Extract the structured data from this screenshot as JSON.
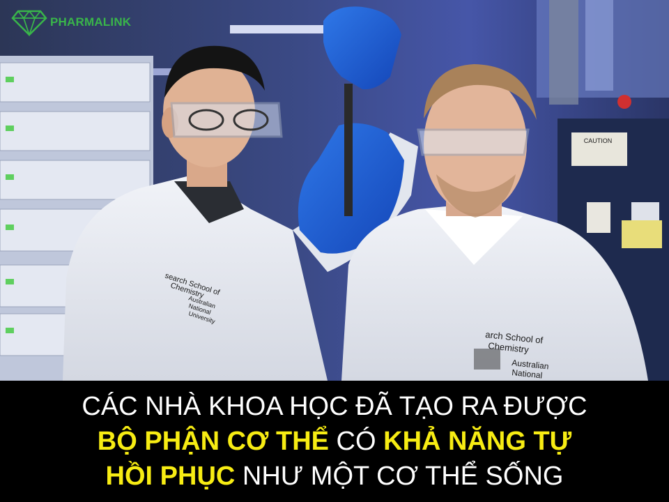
{
  "brand": {
    "name": "PHARMALINK",
    "color": "#39b54a",
    "icon": "diamond-logo-icon"
  },
  "photo": {
    "coat_left": [
      "search School of",
      "Chemistry",
      "Australian",
      "National",
      "University"
    ],
    "coat_right": [
      "arch School of",
      "Chemistry",
      "Australian",
      "National"
    ],
    "signs": [
      "CAUTION"
    ]
  },
  "caption": {
    "line1": "CÁC NHÀ KHOA HỌC ĐÃ TẠO RA ĐƯỢC",
    "line2": {
      "a": "BỘ PHẬN CƠ THỂ",
      "b": " CÓ ",
      "c": "KHẢ NĂNG TỰ"
    },
    "line3": {
      "a": "HỒI PHỤC",
      "b": " NHƯ MỘT CƠ THỂ SỐNG"
    },
    "highlight_color": "#f7ec13",
    "text_color": "#ffffff",
    "background": "#000000"
  }
}
